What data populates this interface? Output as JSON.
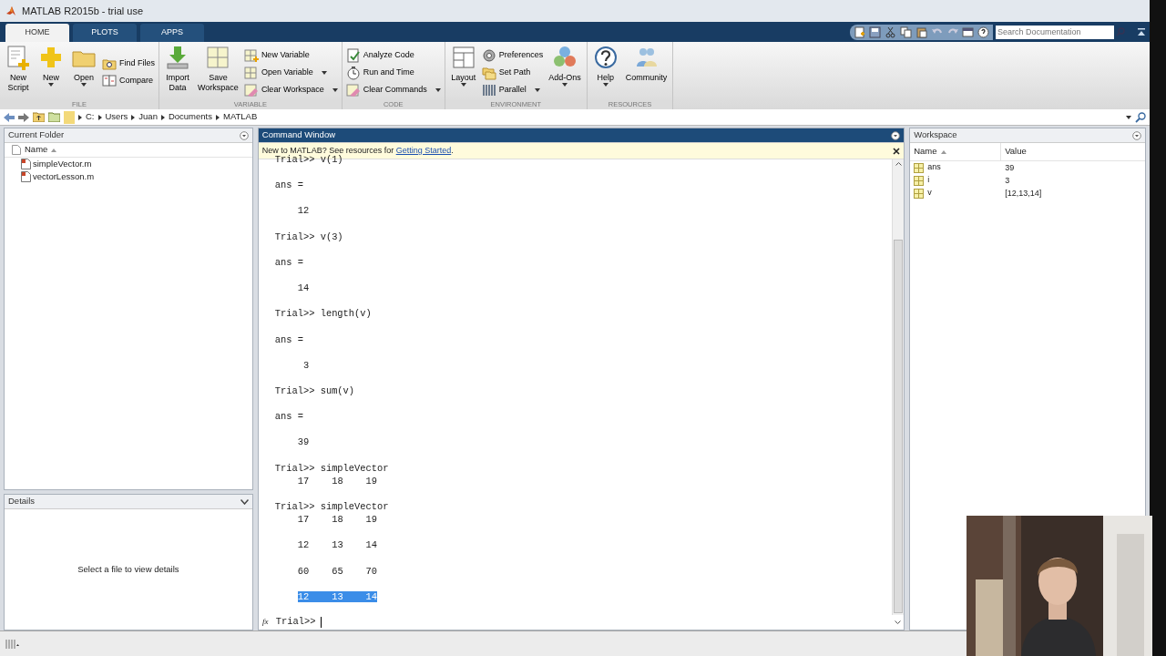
{
  "window": {
    "title": "MATLAB R2015b - trial use"
  },
  "tabs": [
    {
      "label": "HOME",
      "selected": true
    },
    {
      "label": "PLOTS",
      "selected": false
    },
    {
      "label": "APPS",
      "selected": false
    }
  ],
  "search": {
    "placeholder": "Search Documentation"
  },
  "ribbon": {
    "groups": [
      {
        "label": "FILE",
        "items": [
          {
            "kind": "large",
            "label": "New Script",
            "dropdown": false
          },
          {
            "kind": "large",
            "label": "New",
            "dropdown": true
          },
          {
            "kind": "large",
            "label": "Open",
            "dropdown": true
          },
          {
            "kind": "small",
            "label": "Find Files",
            "dropdown": false
          },
          {
            "kind": "small",
            "label": "Compare",
            "dropdown": false
          }
        ]
      },
      {
        "label": "VARIABLE",
        "items": [
          {
            "kind": "large",
            "label": "Import Data",
            "dropdown": false
          },
          {
            "kind": "large",
            "label": "Save Workspace",
            "dropdown": false
          },
          {
            "kind": "small",
            "label": "New Variable",
            "dropdown": false
          },
          {
            "kind": "small",
            "label": "Open Variable",
            "dropdown": true
          },
          {
            "kind": "small",
            "label": "Clear Workspace",
            "dropdown": true
          }
        ]
      },
      {
        "label": "CODE",
        "items": [
          {
            "kind": "small",
            "label": "Analyze Code",
            "dropdown": false
          },
          {
            "kind": "small",
            "label": "Run and Time",
            "dropdown": false
          },
          {
            "kind": "small",
            "label": "Clear Commands",
            "dropdown": true
          }
        ]
      },
      {
        "label": "ENVIRONMENT",
        "items": [
          {
            "kind": "large",
            "label": "Layout",
            "dropdown": true
          },
          {
            "kind": "small",
            "label": "Preferences",
            "dropdown": false
          },
          {
            "kind": "small",
            "label": "Set Path",
            "dropdown": false
          },
          {
            "kind": "small",
            "label": "Parallel",
            "dropdown": true
          },
          {
            "kind": "large",
            "label": "Add-Ons",
            "dropdown": true
          }
        ]
      },
      {
        "label": "RESOURCES",
        "items": [
          {
            "kind": "large",
            "label": "Help",
            "dropdown": true
          },
          {
            "kind": "large",
            "label": "Community",
            "dropdown": false
          }
        ]
      }
    ]
  },
  "address": {
    "path": [
      "C:",
      "Users",
      "Juan",
      "Documents",
      "MATLAB"
    ]
  },
  "current_folder": {
    "title": "Current Folder",
    "column": "Name",
    "files": [
      "simpleVector.m",
      "vectorLesson.m"
    ]
  },
  "details": {
    "title": "Details",
    "message": "Select a file to view details"
  },
  "command_window": {
    "title": "Command Window",
    "banner": {
      "text": "New to MATLAB? See resources for ",
      "link": "Getting Started",
      "after": "."
    },
    "lines": [
      {
        "kind": "input",
        "text": "Trial>> v(1)",
        "selected": false
      },
      {
        "kind": "blank"
      },
      {
        "kind": "output",
        "text": "ans =",
        "selected": false
      },
      {
        "kind": "blank"
      },
      {
        "kind": "output",
        "text": "    12",
        "selected": false
      },
      {
        "kind": "blank"
      },
      {
        "kind": "input",
        "text": "Trial>> v(3)",
        "selected": false
      },
      {
        "kind": "blank"
      },
      {
        "kind": "output",
        "text": "ans =",
        "selected": false
      },
      {
        "kind": "blank"
      },
      {
        "kind": "output",
        "text": "    14",
        "selected": false
      },
      {
        "kind": "blank"
      },
      {
        "kind": "input",
        "text": "Trial>> length(v)",
        "selected": false
      },
      {
        "kind": "blank"
      },
      {
        "kind": "output",
        "text": "ans =",
        "selected": false
      },
      {
        "kind": "blank"
      },
      {
        "kind": "output",
        "text": "     3",
        "selected": false
      },
      {
        "kind": "blank"
      },
      {
        "kind": "input",
        "text": "Trial>> sum(v)",
        "selected": false
      },
      {
        "kind": "blank"
      },
      {
        "kind": "output",
        "text": "ans =",
        "selected": false
      },
      {
        "kind": "blank"
      },
      {
        "kind": "output",
        "text": "    39",
        "selected": false
      },
      {
        "kind": "blank"
      },
      {
        "kind": "input",
        "text": "Trial>> simpleVector",
        "selected": false
      },
      {
        "kind": "output",
        "text": "    17    18    19",
        "selected": false
      },
      {
        "kind": "blank"
      },
      {
        "kind": "input",
        "text": "Trial>> simpleVector",
        "selected": false
      },
      {
        "kind": "output",
        "text": "    17    18    19",
        "selected": false
      },
      {
        "kind": "blank"
      },
      {
        "kind": "output",
        "text": "    12    13    14",
        "selected": false
      },
      {
        "kind": "blank"
      },
      {
        "kind": "output",
        "text": "    60    65    70",
        "selected": false
      },
      {
        "kind": "blank"
      },
      {
        "kind": "output",
        "text": "    12    13    14",
        "selected": true
      },
      {
        "kind": "blank"
      }
    ],
    "prompt": {
      "icon": "fx",
      "text": "Trial>>"
    }
  },
  "workspace": {
    "title": "Workspace",
    "columns": [
      "Name",
      "Value"
    ],
    "variables": [
      {
        "name": "ans",
        "value": "39"
      },
      {
        "name": "i",
        "value": "3"
      },
      {
        "name": "v",
        "value": "[12,13,14]"
      }
    ]
  }
}
